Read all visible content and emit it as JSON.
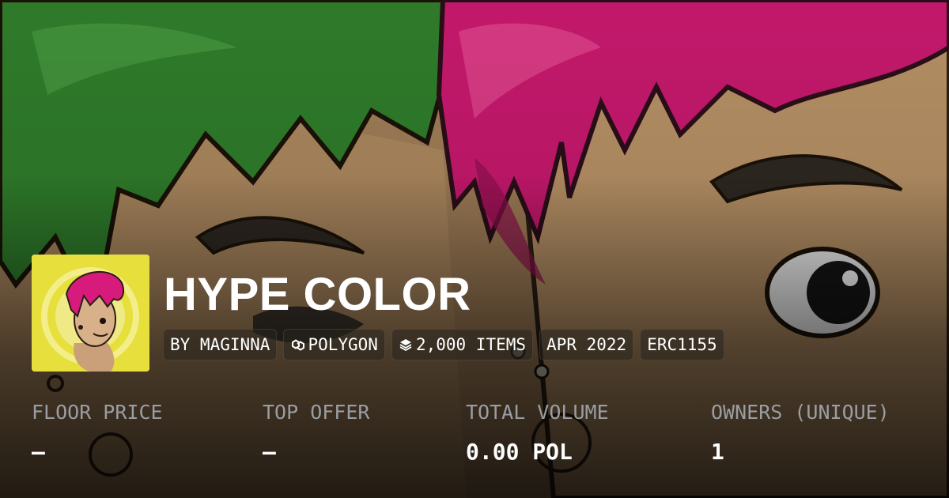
{
  "collection": {
    "title": "HYPE COLOR",
    "chips": [
      {
        "label": "BY MAGINNA",
        "icon": ""
      },
      {
        "label": "POLYGON",
        "icon": "polygon-chain-icon"
      },
      {
        "label": "2,000 ITEMS",
        "icon": "layers-icon"
      },
      {
        "label": "APR 2022",
        "icon": ""
      },
      {
        "label": "ERC1155",
        "icon": ""
      }
    ]
  },
  "stats": [
    {
      "label": "FLOOR PRICE",
      "value": "—"
    },
    {
      "label": "TOP OFFER",
      "value": "—"
    },
    {
      "label": "TOTAL VOLUME",
      "value": "0.00 POL"
    },
    {
      "label": "OWNERS (UNIQUE)",
      "value": "1"
    }
  ],
  "colors": {
    "hair_green": "#2e7a2a",
    "hair_magenta": "#c2186b",
    "skin": "#b48e62",
    "avatar_bg": "#e6df3c",
    "label_gray": "#9a9da2"
  }
}
